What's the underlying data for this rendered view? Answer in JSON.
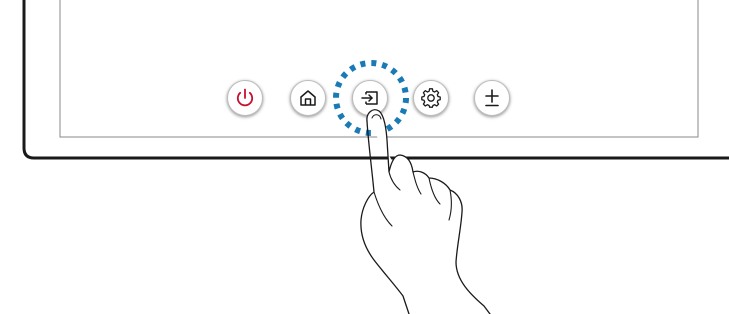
{
  "colors": {
    "frame": "#1a1a1a",
    "screen_border": "#8a8a8a",
    "power_icon": "#c8102e",
    "icon": "#1a1a1a",
    "highlight_ring": "#1a7ab5"
  },
  "buttons": [
    {
      "name": "power",
      "icon": "power-icon"
    },
    {
      "name": "home",
      "icon": "home-icon"
    },
    {
      "name": "source",
      "icon": "source-input-icon",
      "highlighted": true
    },
    {
      "name": "settings",
      "icon": "gear-icon"
    },
    {
      "name": "volume",
      "icon": "plus-minus-icon"
    }
  ],
  "highlight": {
    "style": "dotted-ring",
    "target": "source"
  },
  "pointer": {
    "type": "hand-finger",
    "target": "source"
  }
}
